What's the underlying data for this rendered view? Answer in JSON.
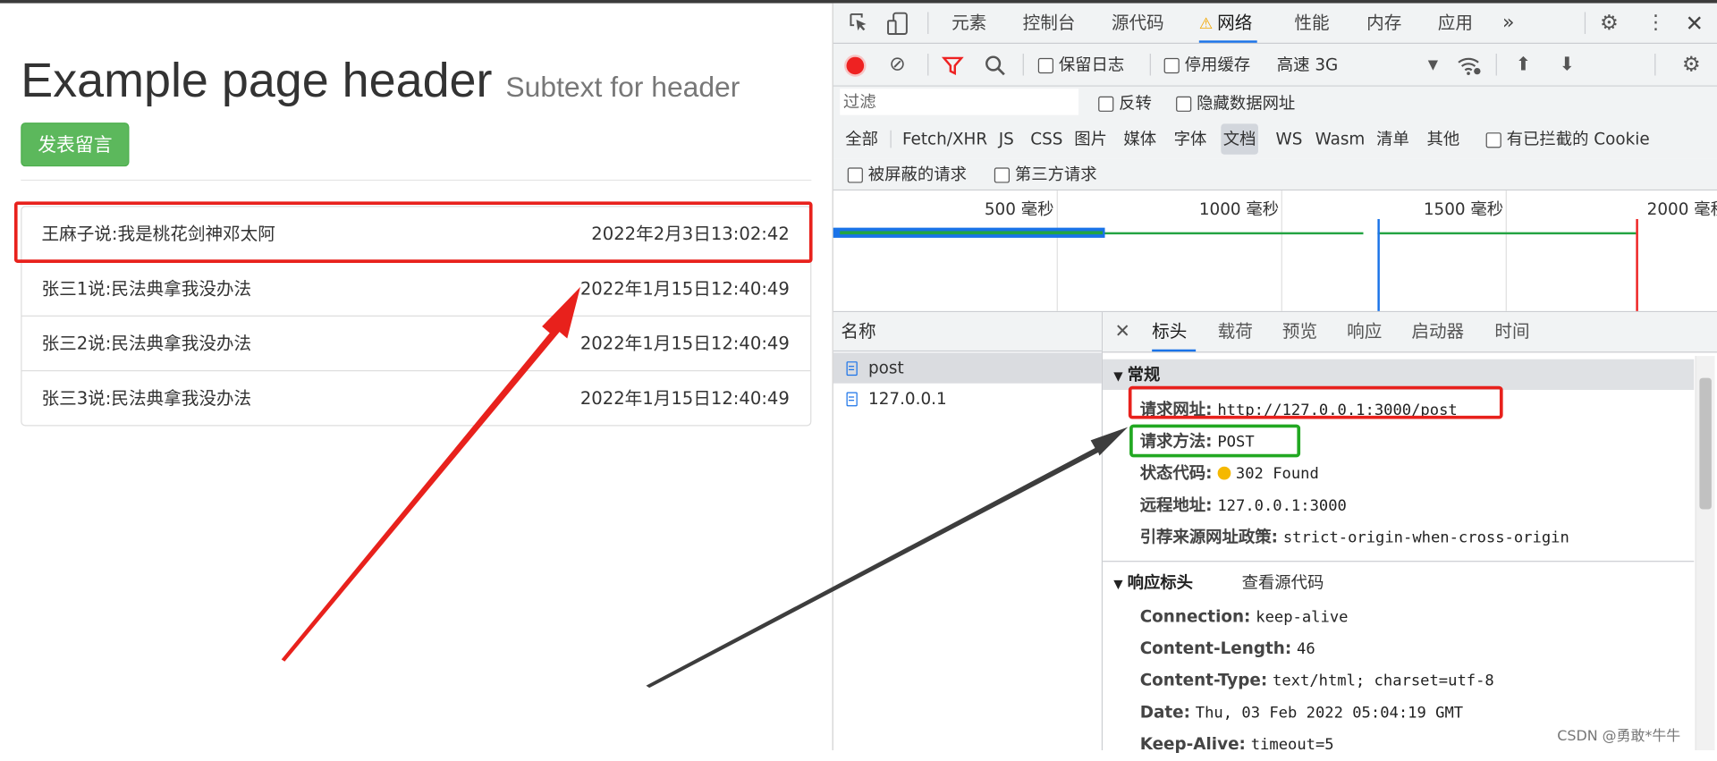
{
  "page": {
    "header_main": "Example page header",
    "header_sub": "Subtext for header",
    "post_button": "发表留言",
    "messages": [
      {
        "text": "王麻子说:我是桃花剑神邓太阿",
        "time": "2022年2月3日13:02:42"
      },
      {
        "text": "张三1说:民法典拿我没办法",
        "time": "2022年1月15日12:40:49"
      },
      {
        "text": "张三2说:民法典拿我没办法",
        "time": "2022年1月15日12:40:49"
      },
      {
        "text": "张三3说:民法典拿我没办法",
        "time": "2022年1月15日12:40:49"
      }
    ]
  },
  "devtools": {
    "tabs": [
      "元素",
      "控制台",
      "源代码",
      "网络",
      "性能",
      "内存",
      "应用"
    ],
    "more_tabs": "»",
    "toolbar": {
      "preserve_log": "保留日志",
      "disable_cache": "停用缓存",
      "throttle": "高速 3G"
    },
    "filter": {
      "placeholder": "过滤",
      "invert": "反转",
      "hide_data_urls": "隐藏数据网址"
    },
    "types": [
      "全部",
      "Fetch/XHR",
      "JS",
      "CSS",
      "图片",
      "媒体",
      "字体",
      "文档",
      "WS",
      "Wasm",
      "清单",
      "其他"
    ],
    "blocked_cookies": "有已拦截的 Cookie",
    "blocked_requests": "被屏蔽的请求",
    "third_party": "第三方请求",
    "timeline_labels": [
      "500 毫秒",
      "1000 毫秒",
      "1500 毫秒",
      "2000 毫秒"
    ],
    "name_header": "名称",
    "requests": [
      "post",
      "127.0.0.1"
    ],
    "detail_tabs": [
      "标头",
      "载荷",
      "预览",
      "响应",
      "启动器",
      "时间"
    ],
    "general": {
      "title": "常规",
      "url_label": "请求网址:",
      "url_value": "http://127.0.0.1:3000/post",
      "method_label": "请求方法:",
      "method_value": "POST",
      "status_label": "状态代码:",
      "status_value": "302 Found",
      "remote_label": "远程地址:",
      "remote_value": "127.0.0.1:3000",
      "referrer_label": "引荐来源网址政策:",
      "referrer_value": "strict-origin-when-cross-origin"
    },
    "response_headers": {
      "title": "响应标头",
      "view_source": "查看源代码",
      "items": [
        {
          "k": "Connection:",
          "v": "keep-alive"
        },
        {
          "k": "Content-Length:",
          "v": "46"
        },
        {
          "k": "Content-Type:",
          "v": "text/html; charset=utf-8"
        },
        {
          "k": "Date:",
          "v": "Thu, 03 Feb 2022 05:04:19 GMT"
        },
        {
          "k": "Keep-Alive:",
          "v": "timeout=5"
        }
      ]
    }
  },
  "watermark": "CSDN @勇敢*牛牛",
  "colors": {
    "annotation_red": "#e8211c",
    "annotation_green": "#22a822",
    "annotation_gray": "#3d3d3d",
    "button_green": "#5cb85c",
    "status_dot": "#f5b800"
  }
}
